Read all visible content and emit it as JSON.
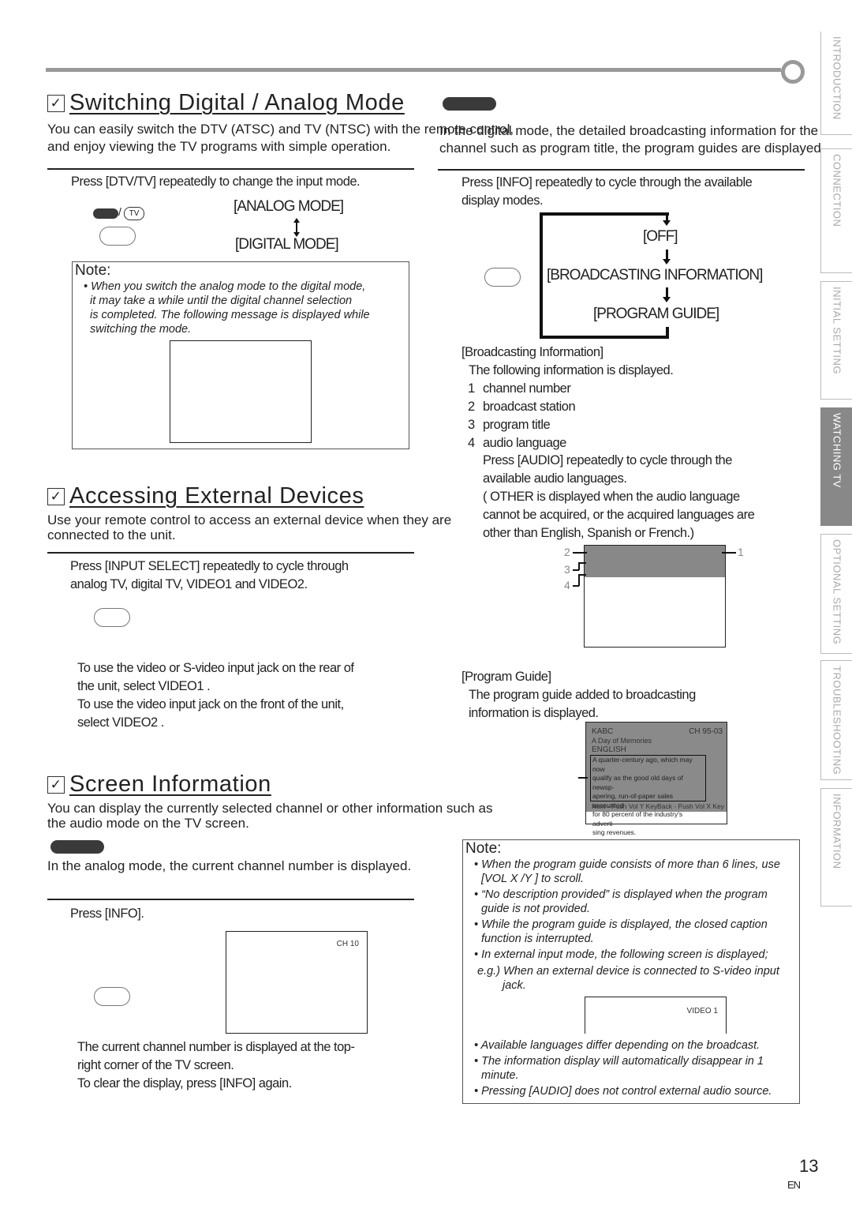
{
  "sections": {
    "switching": {
      "title": "Switching Digital / Analog Mode",
      "intro": [
        "You can easily switch the DTV (ATSC) and TV (NTSC) with the remote control,",
        "and enjoy viewing the TV programs with simple operation."
      ],
      "step": "Press [DTV/TV] repeatedly to change the input mode.",
      "button_label": "TV",
      "modes": [
        "[ANALOG MODE]",
        "[DIGITAL MODE]"
      ],
      "note_heading": "Note:",
      "note": [
        "• When you switch the analog mode to the digital mode,",
        "it may take a while until the digital channel selection",
        "is completed. The following message is displayed while",
        "switching the mode."
      ]
    },
    "digital_info": {
      "intro": [
        "In the digital mode, the detailed broadcasting information for the",
        "channel such as program title, the program guides are displayed."
      ],
      "step": [
        "Press [INFO] repeatedly to cycle through the available",
        "display modes."
      ],
      "cycle": [
        "[OFF]",
        "[BROADCASTING INFORMATION]",
        "[PROGRAM GUIDE]"
      ],
      "broadcast_heading": "[Broadcasting Information]",
      "broadcast_desc": "The following information is displayed.",
      "items": [
        {
          "num": "1",
          "label": "channel number"
        },
        {
          "num": "2",
          "label": "broadcast station"
        },
        {
          "num": "3",
          "label": "program title"
        },
        {
          "num": "4",
          "label": "audio language"
        }
      ],
      "audio_text": [
        "Press [AUDIO] repeatedly to cycle through the",
        "available audio languages.",
        "( OTHER  is displayed when the audio language",
        "cannot be acquired, or the acquired languages are",
        "other than English, Spanish or French.)"
      ],
      "diagram_labels": [
        "2",
        "3",
        "4",
        "1"
      ],
      "guide_heading": "[Program Guide]",
      "guide_desc": [
        "The program guide added to broadcasting",
        "information is displayed."
      ],
      "guide_screen": {
        "station": "KABC",
        "channel": "CH 95-03",
        "title": "A Day of Memories",
        "language": "ENGLISH",
        "description": [
          "A quarter-century ago, which may now",
          "qualify as the good old days of newsp-",
          "apering, run-of-paper sales accounted",
          "for 80 percent of the industry's adverti-",
          "sing revenues."
        ],
        "next": "Next - Push Vol Y Key",
        "back": "Back - Push Vol X Key"
      }
    },
    "external": {
      "title": "Accessing External Devices",
      "intro": [
        "Use your remote control to access an external device when they are",
        "connected to the unit."
      ],
      "step": [
        "Press [INPUT SELECT] repeatedly to cycle through",
        "analog TV, digital TV, VIDEO1 and VIDEO2."
      ],
      "tips": [
        "To use the video or S-video input jack on the rear of",
        "the unit, select  VIDEO1 .",
        "To use the video input jack on the front of the unit,",
        "select  VIDEO2 ."
      ]
    },
    "screen_info": {
      "title": "Screen Information",
      "intro": [
        "You can display the currently selected channel or other information such as",
        "the audio mode on the TV screen."
      ],
      "analog_text": "In the analog mode, the current channel number is displayed.",
      "step": "Press [INFO].",
      "screen_channel": "CH 10",
      "result": [
        "The current channel number is displayed at the top-",
        "right corner of the TV screen.",
        "To clear the display, press [INFO] again."
      ]
    },
    "note2": {
      "heading": "Note:",
      "items": [
        [
          "• When the program guide consists of more than 6 lines, use",
          "[VOL X /Y ] to scroll."
        ],
        [
          "• “No description provided” is displayed when the program",
          "guide is not provided."
        ],
        [
          "• While the program guide is displayed, the closed caption",
          "function is interrupted."
        ],
        [
          "• In external input mode, the following screen is displayed;",
          "e.g.) When an external device is connected to S-video input",
          "jack."
        ],
        [
          "• Available languages differ depending on the broadcast."
        ],
        [
          "• The information display will automatically disappear in 1",
          "minute."
        ],
        [
          "• Pressing [AUDIO] does not control external audio source."
        ]
      ],
      "screen_label": "VIDEO 1"
    }
  },
  "side_tabs": [
    {
      "label": "INTRODUCTION",
      "active": false
    },
    {
      "label": "CONNECTION",
      "active": false
    },
    {
      "label": "INITIAL  SETTING",
      "active": false
    },
    {
      "label": "WATCHING  TV",
      "active": true
    },
    {
      "label": "OPTIONAL  SETTING",
      "active": false
    },
    {
      "label": "TROUBLESHOOTING",
      "active": false
    },
    {
      "label": "INFORMATION",
      "active": false
    }
  ],
  "footer": {
    "page_number": "13",
    "lang": "EN"
  },
  "colors": {
    "accent_gray": "#888888",
    "tab_text": "#aaaaaa",
    "pill": "#3a3a3a"
  }
}
